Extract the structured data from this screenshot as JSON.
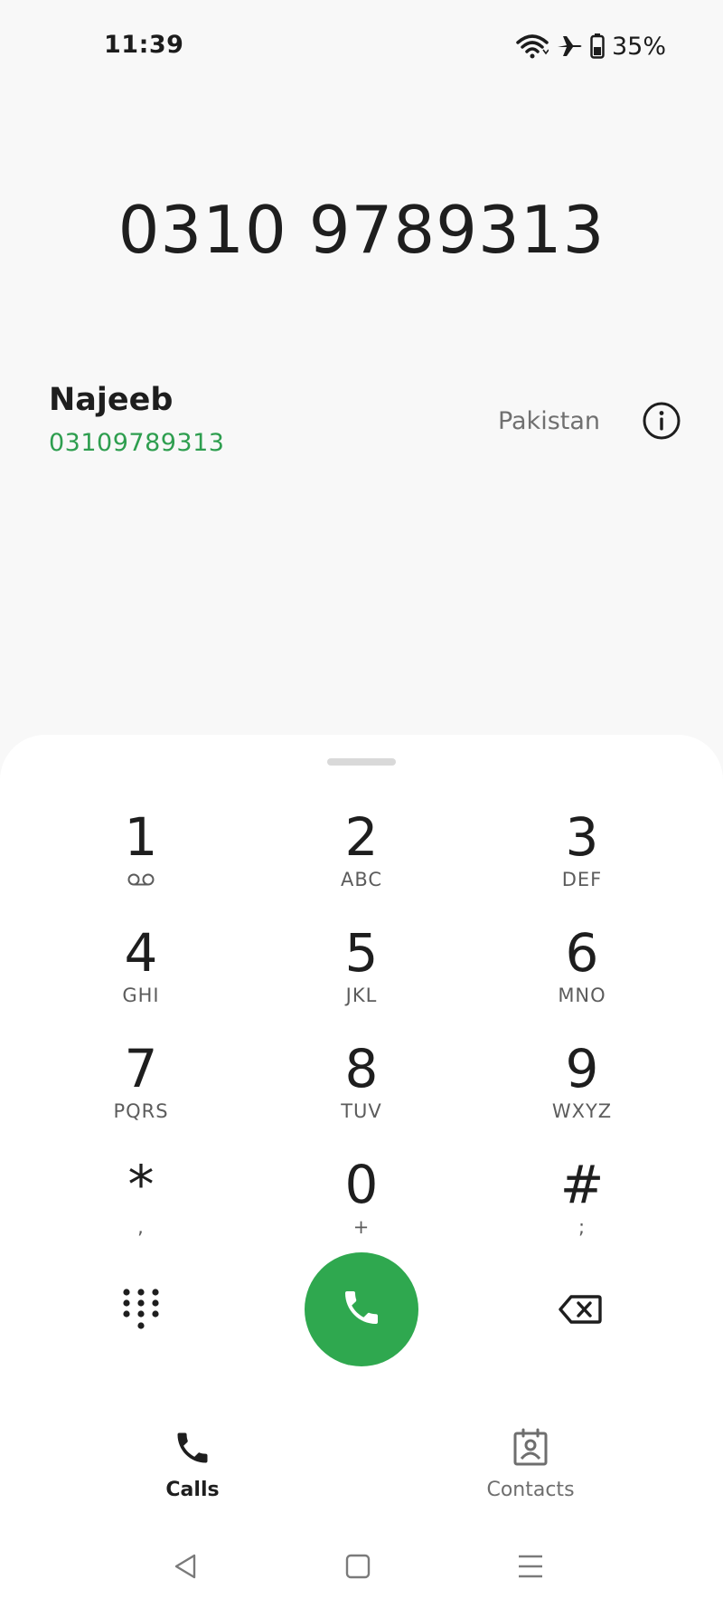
{
  "status_bar": {
    "time": "11:39",
    "battery_percent": "35%",
    "icons": [
      "wifi-icon",
      "airplane-icon",
      "battery-icon"
    ]
  },
  "dialer": {
    "dialed_number": "0310 9789313"
  },
  "contact_match": {
    "name": "Najeeb",
    "number": "03109789313",
    "country": "Pakistan"
  },
  "keypad": {
    "keys": [
      {
        "digit": "1",
        "letters": ""
      },
      {
        "digit": "2",
        "letters": "ABC"
      },
      {
        "digit": "3",
        "letters": "DEF"
      },
      {
        "digit": "4",
        "letters": "GHI"
      },
      {
        "digit": "5",
        "letters": "JKL"
      },
      {
        "digit": "6",
        "letters": "MNO"
      },
      {
        "digit": "7",
        "letters": "PQRS"
      },
      {
        "digit": "8",
        "letters": "TUV"
      },
      {
        "digit": "9",
        "letters": "WXYZ"
      },
      {
        "digit": "*",
        "letters": ","
      },
      {
        "digit": "0",
        "letters": "+"
      },
      {
        "digit": "#",
        "letters": ";"
      }
    ]
  },
  "tabs": {
    "calls_label": "Calls",
    "contacts_label": "Contacts"
  },
  "colors": {
    "accent_green": "#2fa84f",
    "number_green": "#2e9e4f",
    "background": "#f8f8f8"
  }
}
